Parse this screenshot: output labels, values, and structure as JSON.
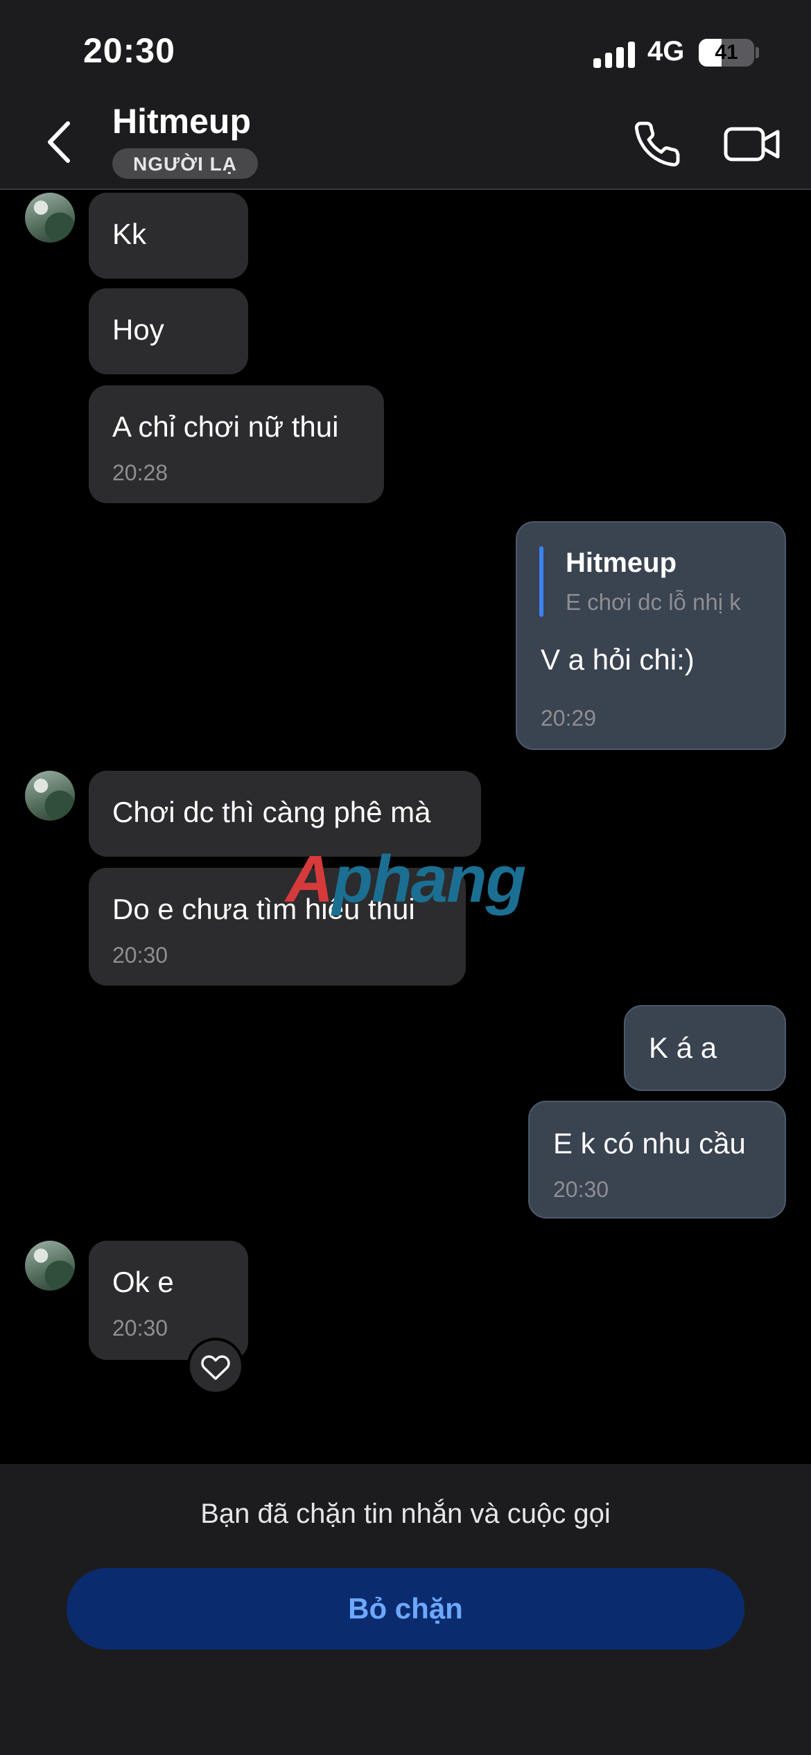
{
  "status_bar": {
    "time": "20:30",
    "network": "4G",
    "battery": "41",
    "battery_level": 0.41
  },
  "header": {
    "name": "Hitmeup",
    "badge": "NGƯỜI LẠ",
    "icons": [
      "chevron-left-icon",
      "phone-icon",
      "video-camera-icon"
    ]
  },
  "messages": [
    {
      "dir": "in",
      "text": "Kk"
    },
    {
      "dir": "in",
      "text": "Hoy"
    },
    {
      "dir": "in",
      "text": "A chỉ chơi nữ thui",
      "time": "20:28"
    },
    {
      "dir": "out",
      "reply_to": {
        "name": "Hitmeup",
        "text": "E chơi dc lỗ nhị k"
      },
      "text": "V a hỏi chi:)",
      "time": "20:29"
    },
    {
      "dir": "in",
      "text": "Chơi dc thì càng phê mà"
    },
    {
      "dir": "in",
      "text": "Do e chưa tìm hiểu thui",
      "time": "20:30"
    },
    {
      "dir": "out",
      "text": "K á a"
    },
    {
      "dir": "out",
      "text": "E k có nhu cầu",
      "time": "20:30"
    },
    {
      "dir": "in",
      "text": "Ok e",
      "time": "20:30",
      "reaction": "heart-icon"
    }
  ],
  "watermark": {
    "part1": "A",
    "part2": "phang"
  },
  "footer": {
    "notice": "Bạn đã chặn tin nhắn và cuộc gọi",
    "button": "Bỏ chặn"
  },
  "colors": {
    "accent": "#3b82f6",
    "unblock_bg": "#0a2c6e",
    "unblock_text": "#6ea8ff"
  }
}
